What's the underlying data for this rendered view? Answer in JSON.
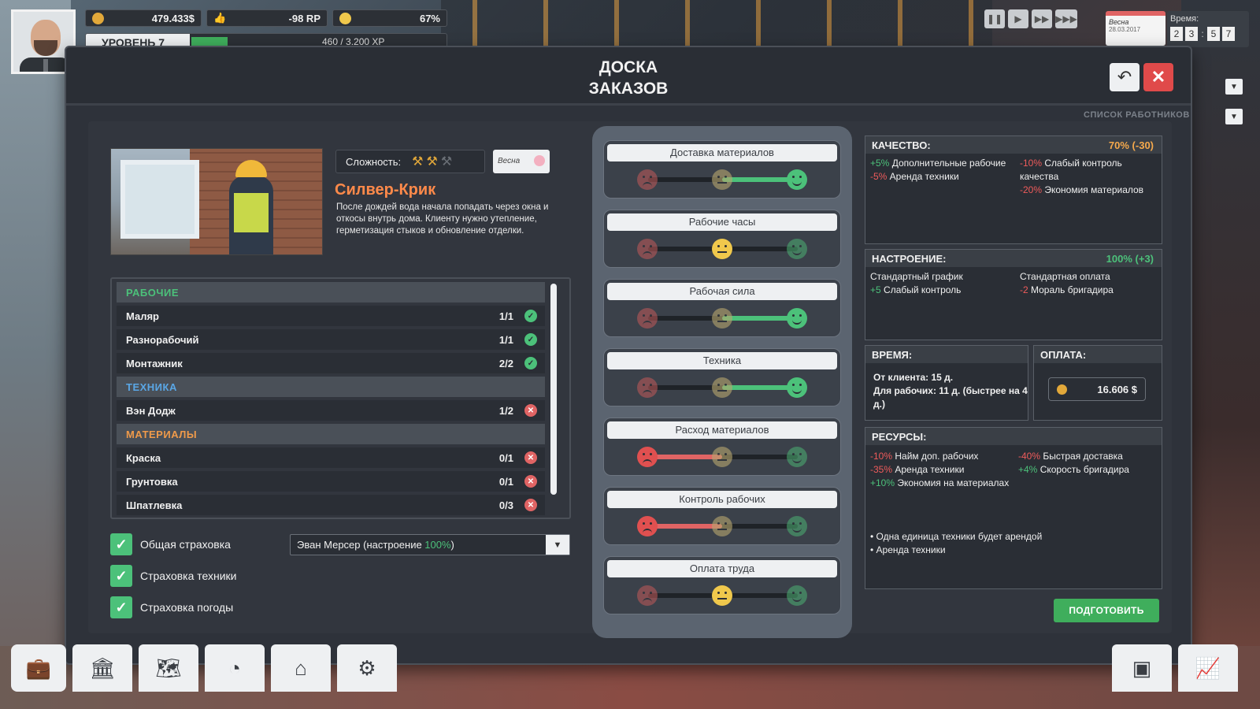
{
  "hud": {
    "money": "479.433$",
    "rp": "-98 RP",
    "mood": "67%",
    "level": "УРОВЕНЬ 7",
    "xp": "460 / 3.200 XP",
    "level_fraction": 0.14
  },
  "calendar": {
    "season": "Весна",
    "date": "28.03.2017"
  },
  "time": {
    "label": "Время:",
    "digits": [
      "2",
      "3",
      "5",
      "7"
    ]
  },
  "panel": {
    "title_line1": "ДОСКА",
    "title_line2": "ЗАКАЗОВ",
    "workers_list_label": "СПИСОК РАБОТНИКОВ"
  },
  "job": {
    "complexity_label": "Сложность:",
    "complexity": {
      "level": 2,
      "max": 3
    },
    "season_badge": "Весна",
    "name": "Силвер-Крик",
    "description": "После дождей вода начала попадать через окна и откосы внутрь дома. Клиенту нужно утепление, герметизация стыков и обновление отделки."
  },
  "requirements": {
    "workers_header": "РАБОЧИЕ",
    "workers": [
      {
        "name": "Маляр",
        "count": "1/1",
        "ok": true
      },
      {
        "name": "Разнорабочий",
        "count": "1/1",
        "ok": true
      },
      {
        "name": "Монтажник",
        "count": "2/2",
        "ok": true
      }
    ],
    "equipment_header": "ТЕХНИКА",
    "equipment": [
      {
        "name": "Вэн Додж",
        "count": "1/2",
        "ok": false
      }
    ],
    "materials_header": "МАТЕРИАЛЫ",
    "materials": [
      {
        "name": "Краска",
        "count": "0/1",
        "ok": false
      },
      {
        "name": "Грунтовка",
        "count": "0/1",
        "ok": false
      },
      {
        "name": "Шпатлевка",
        "count": "0/3",
        "ok": false
      }
    ]
  },
  "insurance": {
    "general": "Общая страховка",
    "equipment": "Страховка техники",
    "weather": "Страховка погоды"
  },
  "foreman": {
    "name_prefix": "Эван Мерсер (настроение ",
    "mood": "100%",
    "suffix": ")"
  },
  "sliders": [
    {
      "label": "Доставка материалов",
      "value": 1.0
    },
    {
      "label": "Рабочие часы",
      "value": 0.5
    },
    {
      "label": "Рабочая сила",
      "value": 1.0
    },
    {
      "label": "Техника",
      "value": 1.0
    },
    {
      "label": "Расход материалов",
      "value": 0.0
    },
    {
      "label": "Контроль рабочих",
      "value": 0.0
    },
    {
      "label": "Оплата труда",
      "value": 0.5
    }
  ],
  "quality": {
    "header": "КАЧЕСТВО:",
    "value": "70% (-30)",
    "left": [
      {
        "pct": "+5%",
        "text": " Дополнительные рабочие",
        "sign": "pos"
      },
      {
        "pct": "-5%",
        "text": " Аренда техники",
        "sign": "neg"
      }
    ],
    "right": [
      {
        "pct": "-10%",
        "text": " Слабый контроль качества",
        "sign": "neg"
      },
      {
        "pct": "-20%",
        "text": " Экономия материалов",
        "sign": "neg"
      }
    ]
  },
  "mood": {
    "header": "НАСТРОЕНИЕ:",
    "value": "100% (+3)",
    "left": [
      {
        "pct": "",
        "text": "Стандартный график",
        "sign": ""
      },
      {
        "pct": "+5",
        "text": " Слабый контроль",
        "sign": "pos"
      }
    ],
    "right": [
      {
        "pct": "",
        "text": "Стандартная оплата",
        "sign": ""
      },
      {
        "pct": "-2",
        "text": " Мораль бригадира",
        "sign": "neg"
      }
    ]
  },
  "time_box": {
    "header": "ВРЕМЯ:",
    "client": "От клиента: 15 д.",
    "workers": "Для рабочих: 11 д. (быстрее на 4 д.)"
  },
  "payment": {
    "header": "ОПЛАТА:",
    "value": "16.606 $"
  },
  "resources": {
    "header": "РЕСУРСЫ:",
    "left": [
      {
        "pct": "-10%",
        "text": " Найм доп. рабочих",
        "sign": "neg"
      },
      {
        "pct": "-35%",
        "text": " Аренда техники",
        "sign": "neg"
      },
      {
        "pct": "+10%",
        "text": " Экономия на материалах",
        "sign": "pos"
      }
    ],
    "right": [
      {
        "pct": "-40%",
        "text": " Быстрая доставка",
        "sign": "neg"
      },
      {
        "pct": "+4%",
        "text": " Скорость бригадира",
        "sign": "pos"
      }
    ],
    "notes": [
      "• Одна единица техники будет арендой",
      "• Аренда техники"
    ]
  },
  "prepare_button": "ПОДГОТОВИТЬ"
}
